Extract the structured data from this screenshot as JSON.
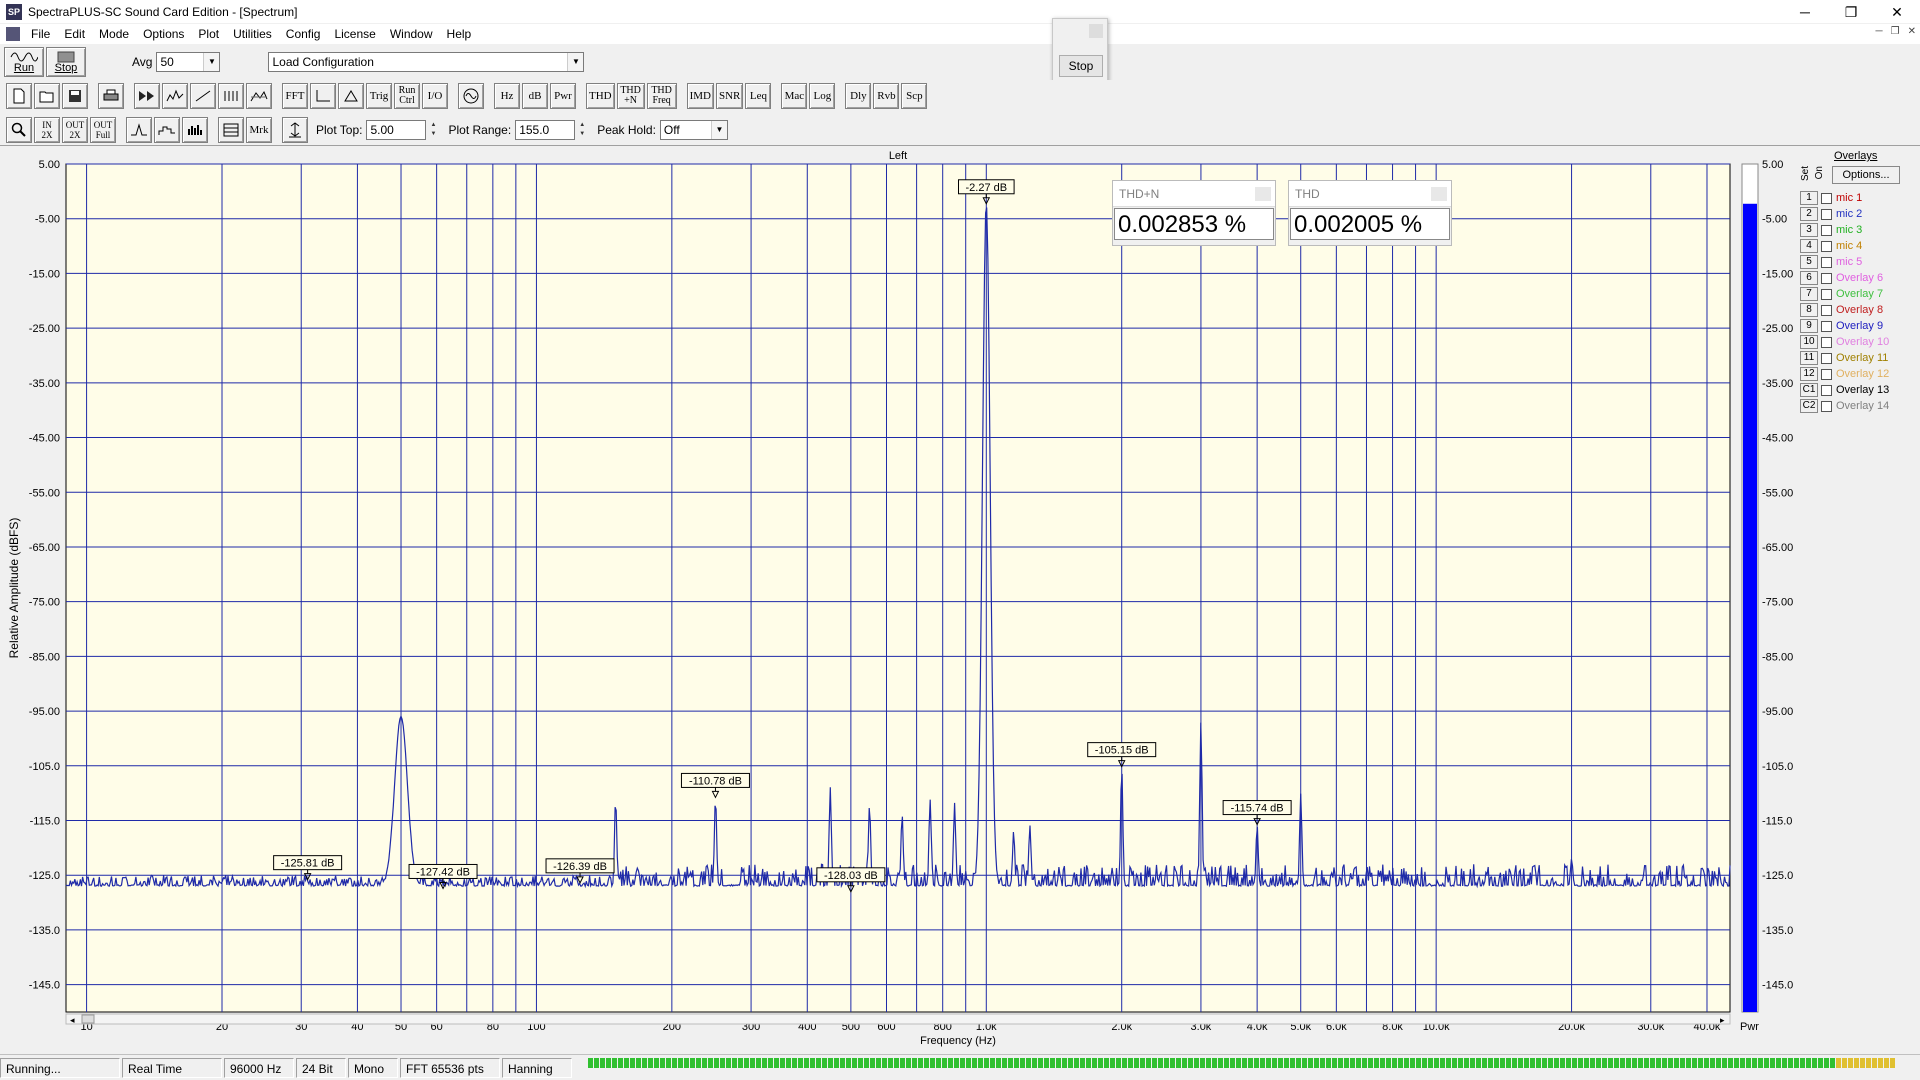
{
  "window": {
    "title": "SpectraPLUS-SC Sound Card Edition - [Spectrum]",
    "app_icon_text": "SP",
    "min": "─",
    "restore": "❐",
    "close": "✕"
  },
  "menu": [
    "File",
    "Edit",
    "Mode",
    "Options",
    "Plot",
    "Utilities",
    "Config",
    "License",
    "Window",
    "Help"
  ],
  "toolbar1": {
    "run": "Run",
    "stop": "Stop",
    "avg_label": "Avg",
    "avg_value": "50",
    "config_value": "Load Configuration"
  },
  "toolbar2": {
    "group1": [
      "",
      "",
      "",
      ""
    ],
    "group2": [
      "",
      "",
      "",
      "",
      "",
      ""
    ],
    "group3": [
      "FFT",
      "",
      "",
      "Trig",
      "Run Ctrl",
      "I/O"
    ],
    "group4": [
      "",
      "Hz",
      "dB",
      "Pwr"
    ],
    "group5": [
      "THD",
      "THD +N",
      "THD Freq"
    ],
    "group6": [
      "IMD",
      "SNR",
      "Leq"
    ],
    "group7": [
      "Mac",
      "Log"
    ],
    "group8": [
      "Dly",
      "Rvb",
      "Scp"
    ]
  },
  "toolbar3": {
    "zoom_buttons": [
      "",
      "IN 2X",
      "OUT 2X",
      "OUT Full"
    ],
    "view_buttons": [
      "",
      "",
      ""
    ],
    "mrk": "Mrk",
    "plot_top_label": "Plot Top:",
    "plot_top_value": "5.00",
    "plot_range_label": "Plot Range:",
    "plot_range_value": "155.0",
    "peak_hold_label": "Peak Hold:",
    "peak_hold_value": "Off"
  },
  "floating_stop": {
    "label": "Stop"
  },
  "meters": [
    {
      "name": "THD+N",
      "value": "0.002853 %"
    },
    {
      "name": "THD",
      "value": "0.002005 %"
    }
  ],
  "overlays": {
    "title": "Overlays",
    "options": "Options...",
    "set_label": "Set",
    "on_label": "On",
    "items": [
      {
        "num": "1",
        "name": "mic 1",
        "color": "#c00000"
      },
      {
        "num": "2",
        "name": "mic 2",
        "color": "#2030c0"
      },
      {
        "num": "3",
        "name": "mic 3",
        "color": "#20b020"
      },
      {
        "num": "4",
        "name": "mic 4",
        "color": "#c08000"
      },
      {
        "num": "5",
        "name": "mic 5",
        "color": "#e060e0"
      },
      {
        "num": "6",
        "name": "Overlay 6",
        "color": "#e060e0"
      },
      {
        "num": "7",
        "name": "Overlay 7",
        "color": "#40c040"
      },
      {
        "num": "8",
        "name": "Overlay 8",
        "color": "#c02020"
      },
      {
        "num": "9",
        "name": "Overlay 9",
        "color": "#2020c0"
      },
      {
        "num": "10",
        "name": "Overlay 10",
        "color": "#e080e0"
      },
      {
        "num": "11",
        "name": "Overlay 11",
        "color": "#a08000"
      },
      {
        "num": "12",
        "name": "Overlay 12",
        "color": "#e0b060"
      },
      {
        "num": "C1",
        "name": "Overlay 13",
        "color": "#000000"
      },
      {
        "num": "C2",
        "name": "Overlay 14",
        "color": "#808080"
      }
    ]
  },
  "status": [
    "Running...",
    "Real Time",
    "96000 Hz",
    "24 Bit",
    "Mono",
    "FFT 65536 pts",
    "Hanning"
  ],
  "chart_data": {
    "type": "line",
    "title": "Left",
    "xlabel": "Frequency (Hz)",
    "ylabel": "Relative Amplitude (dBFS)",
    "xscale": "log",
    "xlim": [
      9,
      45000
    ],
    "ylim": [
      -150,
      5
    ],
    "y_ticks": [
      5,
      -5,
      -15,
      -25,
      -35,
      -45,
      -55,
      -65,
      -75,
      -85,
      -95,
      -105,
      -115,
      -125,
      -135,
      -145
    ],
    "y_tick_labels": [
      "5.00",
      "-5.00",
      "-15.00",
      "-25.00",
      "-35.00",
      "-45.00",
      "-55.00",
      "-65.00",
      "-75.00",
      "-85.00",
      "-95.00",
      "-105.0",
      "-115.0",
      "-125.0",
      "-135.0",
      "-145.0"
    ],
    "x_ticks": [
      10,
      20,
      30,
      40,
      50,
      60,
      80,
      100,
      200,
      300,
      400,
      500,
      600,
      800,
      1000,
      2000,
      3000,
      4000,
      5000,
      6000,
      8000,
      10000,
      20000,
      30000,
      40000
    ],
    "x_tick_labels": [
      "10",
      "20",
      "30",
      "40",
      "50",
      "60",
      "80",
      "100",
      "200",
      "300",
      "400",
      "500",
      "600",
      "800",
      "1.0k",
      "2.0k",
      "3.0k",
      "4.0k",
      "5.0k",
      "6.0k",
      "8.0k",
      "10.0k",
      "20.0k",
      "30.0k",
      "40.0k"
    ],
    "x_minor_ticks": [
      70,
      90,
      700,
      900,
      7000,
      9000
    ],
    "noise_floor": -127,
    "peaks": [
      {
        "f": 50,
        "a": -96
      },
      {
        "f": 150,
        "a": -111
      },
      {
        "f": 250,
        "a": -110.8
      },
      {
        "f": 450,
        "a": -109
      },
      {
        "f": 550,
        "a": -112
      },
      {
        "f": 650,
        "a": -114
      },
      {
        "f": 750,
        "a": -111
      },
      {
        "f": 850,
        "a": -112
      },
      {
        "f": 1000,
        "a": -2.27
      },
      {
        "f": 1150,
        "a": -117
      },
      {
        "f": 1250,
        "a": -116
      },
      {
        "f": 2000,
        "a": -105.15
      },
      {
        "f": 3000,
        "a": -97
      },
      {
        "f": 4000,
        "a": -115.74
      },
      {
        "f": 5000,
        "a": -110
      },
      {
        "f": 20000,
        "a": -122
      }
    ],
    "markers": [
      {
        "f": 31,
        "a": -125.81,
        "label": "-125.81 dB"
      },
      {
        "f": 62,
        "a": -127.42,
        "label": "-127.42 dB"
      },
      {
        "f": 125,
        "a": -126.39,
        "label": "-126.39 dB"
      },
      {
        "f": 250,
        "a": -110.78,
        "label": "-110.78 dB"
      },
      {
        "f": 500,
        "a": -128.03,
        "label": "-128.03 dB"
      },
      {
        "f": 1000,
        "a": -2.27,
        "label": "-2.27 dB"
      },
      {
        "f": 2000,
        "a": -105.15,
        "label": "-105.15 dB"
      },
      {
        "f": 4000,
        "a": -115.74,
        "label": "-115.74 dB"
      }
    ],
    "bar_meter": {
      "label": "Pwr",
      "value": -2.27,
      "color": "#0000ff"
    },
    "colors": {
      "background": "#fffde8",
      "grid": "#1f2aa8",
      "trace": "#1f2aa8",
      "axis_text": "#000000"
    }
  }
}
